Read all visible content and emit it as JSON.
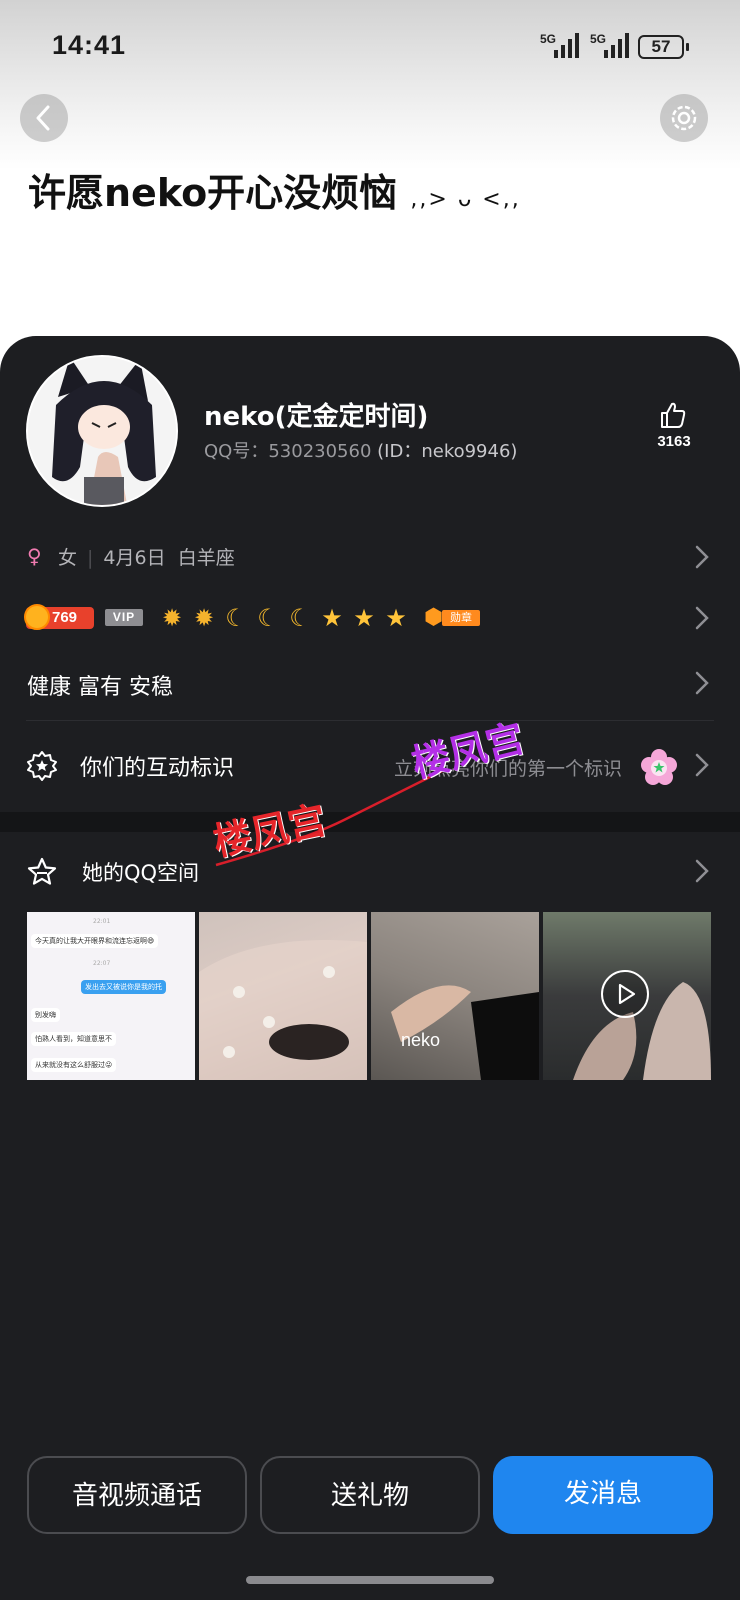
{
  "status_bar": {
    "time": "14:41",
    "sim1_label": "5G",
    "sim2_label": "5G",
    "battery": "57"
  },
  "header": {
    "back_icon": "chevron-left-icon",
    "settings_icon": "gear-icon"
  },
  "signature": {
    "text": "许愿neko开心没烦恼",
    "decoration": ",,> ᴗ <,,"
  },
  "profile": {
    "nickname": "neko(定金定时间)",
    "qq_label": "QQ号：530230560",
    "id_label": "(ID：neko9946)",
    "likes": "3163"
  },
  "info": {
    "gender_symbol": "♀",
    "gender": "女",
    "birthday": "4月6日",
    "zodiac": "白羊座"
  },
  "badges": {
    "level_number": "769",
    "vip_label": "VIP",
    "level_icons": [
      "sun",
      "sun",
      "moon",
      "moon",
      "moon",
      "star",
      "star",
      "star"
    ],
    "medal_label": "勋章"
  },
  "wish": {
    "text": "健康 富有 安稳"
  },
  "interaction": {
    "label": "你们的互动标识",
    "hint": "立刻点亮你们的第一个标识"
  },
  "qzone": {
    "label": "她的QQ空间",
    "photo1": {
      "time1": "22:01",
      "msg1": "今天真的让我大开眼界和流连忘返啊😄",
      "time2": "22:07",
      "msg2": "发出去又被说你是我的托",
      "msg3": "别发嗨",
      "msg4": "怕熟人看到，知道意思不",
      "msg5": "从来就没有这么舒服过😜"
    },
    "photo3_watermark": "neko"
  },
  "watermark": {
    "text1": "楼凤宫",
    "text2": "楼凤宫"
  },
  "actions": {
    "call": "音视频通话",
    "gift": "送礼物",
    "message": "发消息"
  },
  "colors": {
    "card_bg": "#1d1e21",
    "primary": "#1f86ef",
    "level_badge": "#e8412c",
    "gender": "#f07bb0"
  }
}
